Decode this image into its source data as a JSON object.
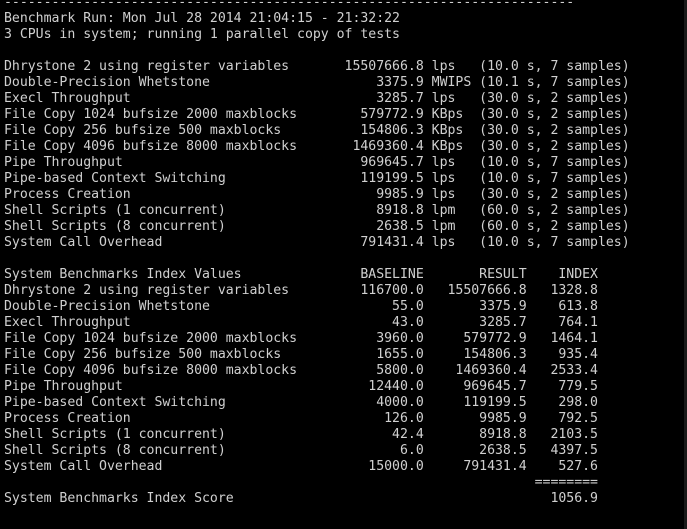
{
  "terminal": {
    "lines": [
      "------------------------------------------------------------------------",
      "Benchmark Run: Mon Jul 28 2014 21:04:15 - 21:32:22",
      "3 CPUs in system; running 1 parallel copy of tests",
      "",
      "Dhrystone 2 using register variables       15507666.8 lps   (10.0 s, 7 samples)",
      "Double-Precision Whetstone                     3375.9 MWIPS (10.1 s, 7 samples)",
      "Execl Throughput                               3285.7 lps   (30.0 s, 2 samples)",
      "File Copy 1024 bufsize 2000 maxblocks        579772.9 KBps  (30.0 s, 2 samples)",
      "File Copy 256 bufsize 500 maxblocks          154806.3 KBps  (30.0 s, 2 samples)",
      "File Copy 4096 bufsize 8000 maxblocks       1469360.4 KBps  (30.0 s, 2 samples)",
      "Pipe Throughput                              969645.7 lps   (10.0 s, 7 samples)",
      "Pipe-based Context Switching                 119199.5 lps   (10.0 s, 7 samples)",
      "Process Creation                               9985.9 lps   (30.0 s, 2 samples)",
      "Shell Scripts (1 concurrent)                   8918.8 lpm   (60.0 s, 2 samples)",
      "Shell Scripts (8 concurrent)                   2638.5 lpm   (60.0 s, 2 samples)",
      "System Call Overhead                         791431.4 lps   (10.0 s, 7 samples)",
      "",
      "System Benchmarks Index Values               BASELINE       RESULT    INDEX",
      "Dhrystone 2 using register variables         116700.0   15507666.8   1328.8",
      "Double-Precision Whetstone                       55.0       3375.9    613.8",
      "Execl Throughput                                 43.0       3285.7    764.1",
      "File Copy 1024 bufsize 2000 maxblocks          3960.0     579772.9   1464.1",
      "File Copy 256 bufsize 500 maxblocks            1655.0     154806.3    935.4",
      "File Copy 4096 bufsize 8000 maxblocks          5800.0    1469360.4   2533.4",
      "Pipe Throughput                               12440.0     969645.7    779.5",
      "Pipe-based Context Switching                   4000.0     119199.5    298.0",
      "Process Creation                                126.0       9985.9    792.5",
      "Shell Scripts (1 concurrent)                     42.4       8918.8   2103.5",
      "Shell Scripts (8 concurrent)                      6.0       2638.5   4397.5",
      "System Call Overhead                          15000.0     791431.4    527.6",
      "                                                                   ========",
      "System Benchmarks Index Score                                        1056.9"
    ]
  }
}
